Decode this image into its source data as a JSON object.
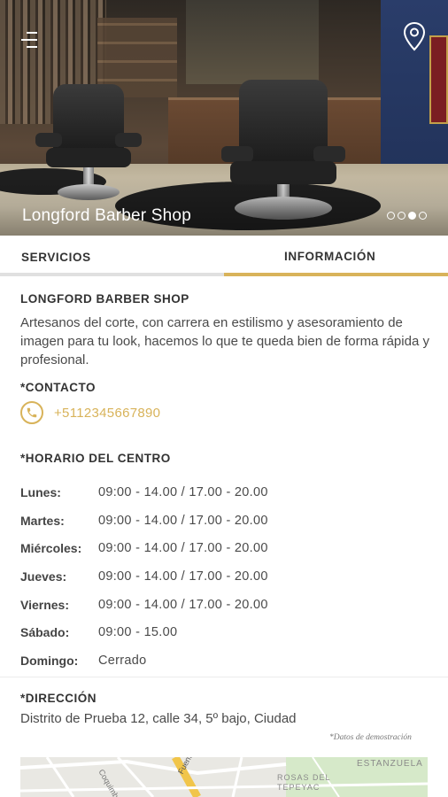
{
  "hero": {
    "title": "Longford Barber Shop",
    "slides": 4,
    "active_slide": 3
  },
  "icons": {
    "menu": "menu-icon",
    "location": "map-pin-icon",
    "phone": "phone-icon"
  },
  "colors": {
    "accent": "#d8b35a",
    "text": "#3a3a3a",
    "tab_inactive_bar": "#e0e0e0"
  },
  "tabs": [
    {
      "label": "SERVICIOS",
      "active": false
    },
    {
      "label": "INFORMACIÓN",
      "active": true
    }
  ],
  "info": {
    "name": "LONGFORD BARBER SHOP",
    "description": "Artesanos del corte, con carrera en estilismo y asesoramiento de imagen para tu look, hacemos lo que te queda bien de forma rápida y profesional.",
    "contact_heading": "*CONTACTO",
    "phone": "+5112345667890",
    "hours_heading": "*HORARIO DEL CENTRO",
    "hours": [
      {
        "day": "Lunes:",
        "time": "09:00 - 14.00  /  17.00 - 20.00"
      },
      {
        "day": "Martes:",
        "time": "09:00 - 14.00  /  17.00 - 20.00"
      },
      {
        "day": "Miércoles:",
        "time": "09:00 - 14.00  /  17.00 - 20.00"
      },
      {
        "day": "Jueves:",
        "time": "09:00 - 14.00  /  17.00 - 20.00"
      },
      {
        "day": "Viernes:",
        "time": "09:00 - 14.00  /  17.00 - 20.00"
      },
      {
        "day": "Sábado:",
        "time": "09:00 - 15.00"
      },
      {
        "day": "Domingo:",
        "time": "Cerrado"
      }
    ],
    "address_heading": "*DIRECCIÓN",
    "address": "Distrito de Prueba 12, calle 34, 5º bajo, Ciudad",
    "demo_note": "*Datos de demostración"
  },
  "map": {
    "labels": [
      "ESTANZUELA",
      "ROSAS DEL TEPEYAC",
      "Fuentes Ne",
      "Coquimbo"
    ]
  }
}
